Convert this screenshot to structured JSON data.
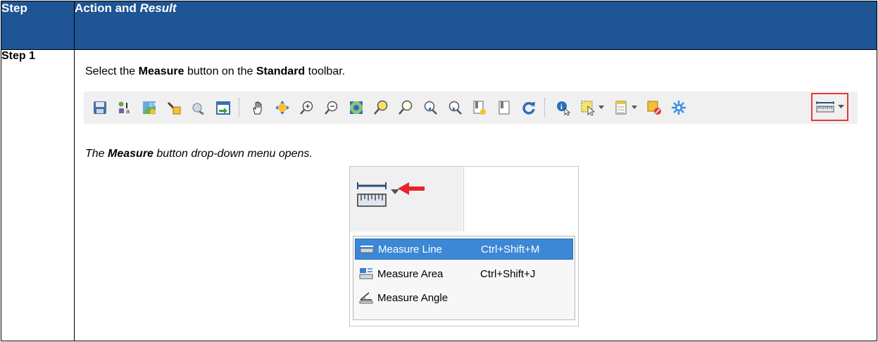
{
  "table": {
    "header_step": "Step",
    "header_action": "Action and ",
    "header_result": "Result"
  },
  "row": {
    "step_label": "Step 1",
    "instruction": {
      "pre": "Select the ",
      "b1": "Measure",
      "mid": " button on the ",
      "b2": "Standard",
      "post": " toolbar."
    },
    "result": {
      "pre": "The ",
      "bold": "Measure",
      "post": " button drop-down menu opens."
    }
  },
  "toolbar": {
    "icons": [
      "save-icon",
      "style-manager-icon",
      "new-map-icon",
      "pan-to-selection-icon",
      "identify-map-icon",
      "save-as-image-icon",
      "pan-icon",
      "pan-map-icon",
      "zoom-in-icon",
      "zoom-out-icon",
      "zoom-full-icon",
      "zoom-to-selection-icon",
      "zoom-to-layer-icon",
      "zoom-last-icon",
      "zoom-next-icon",
      "new-bookmark-icon",
      "show-bookmarks-icon",
      "refresh-icon",
      "identify-features-icon",
      "select-features-icon",
      "open-attribute-table-icon",
      "deselect-features-icon",
      "statistics-icon",
      "measure-icon"
    ]
  },
  "menu": {
    "items": [
      {
        "label": "Measure Line",
        "shortcut": "Ctrl+Shift+M",
        "selected": true
      },
      {
        "label": "Measure Area",
        "shortcut": "Ctrl+Shift+J",
        "selected": false
      },
      {
        "label": "Measure Angle",
        "shortcut": "",
        "selected": false
      }
    ]
  },
  "colors": {
    "header_bg": "#1f5495",
    "highlight_box": "#e23b3b",
    "menu_selected": "#3c87d6",
    "arrow": "#e8242a"
  }
}
